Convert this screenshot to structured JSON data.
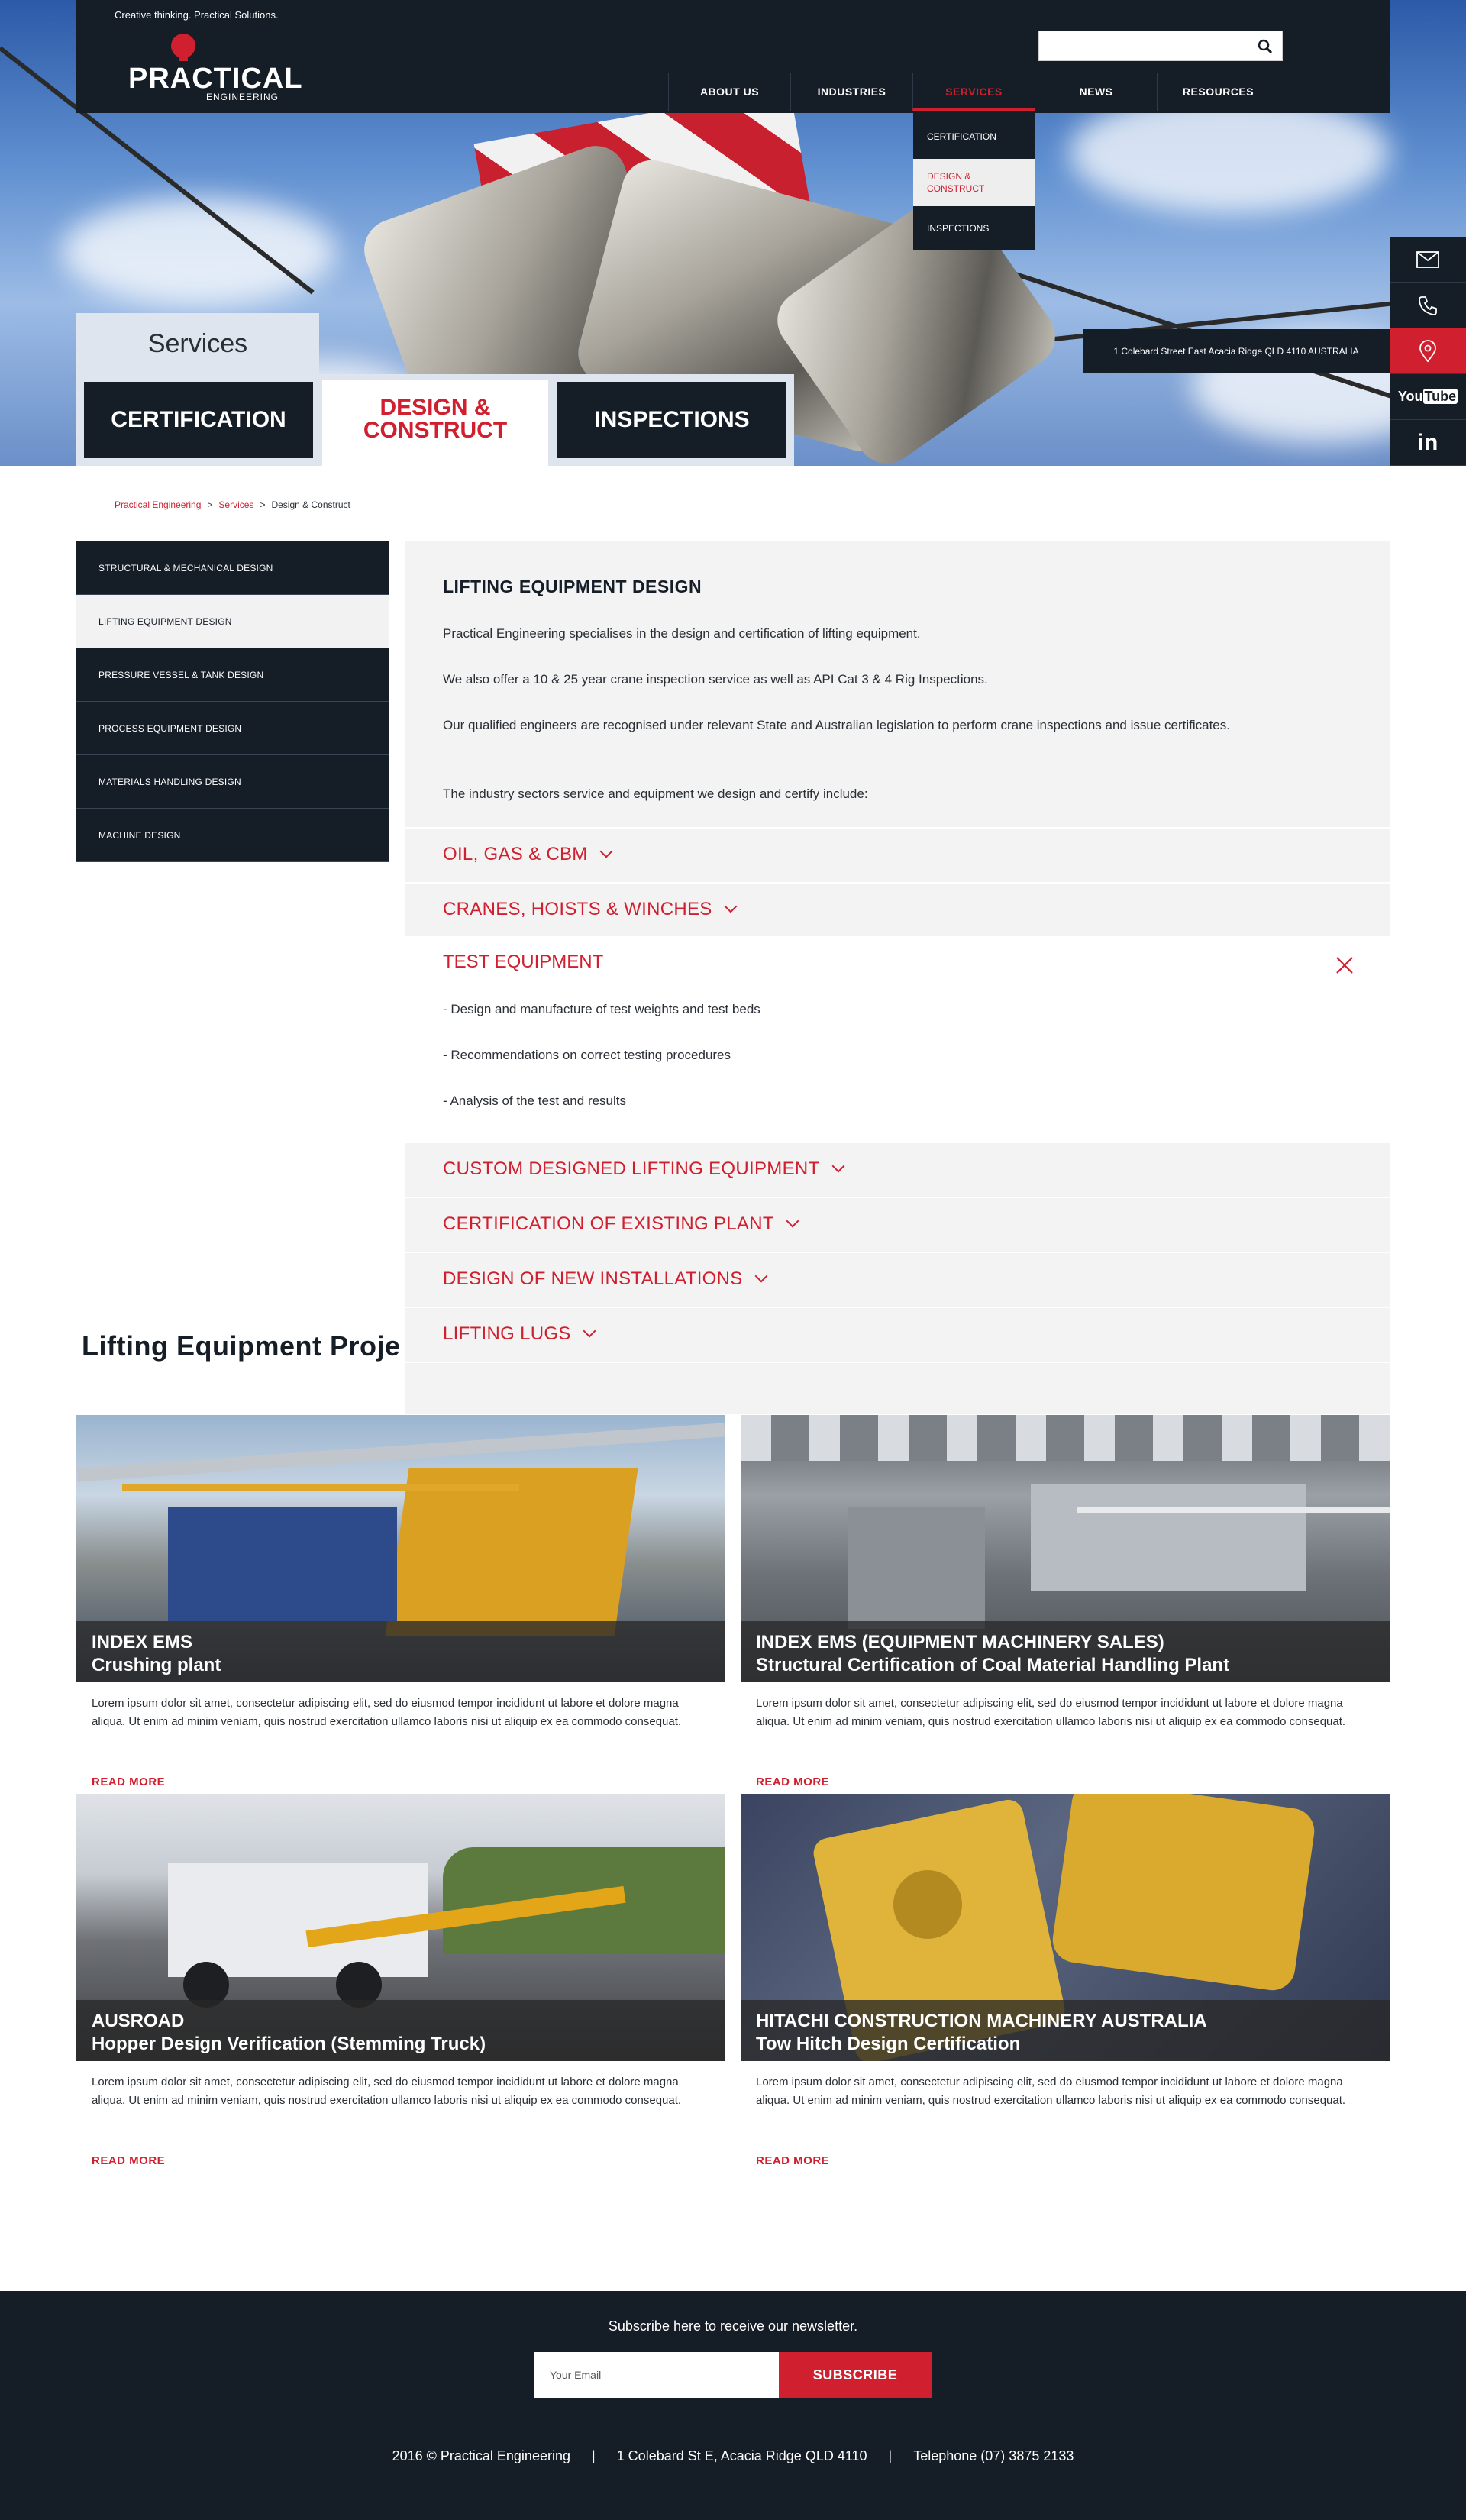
{
  "header": {
    "tagline": "Creative thinking. Practical Solutions.",
    "logo_word": "PRACTICAL",
    "logo_sub": "ENGINEERING",
    "search_placeholder": "",
    "nav": [
      "ABOUT US",
      "INDUSTRIES",
      "SERVICES",
      "NEWS",
      "RESOURCES"
    ],
    "active_nav": "SERVICES",
    "dropdown": [
      "CERTIFICATION",
      "DESIGN & CONSTRUCT",
      "INSPECTIONS"
    ]
  },
  "hero": {
    "panel_title": "Services",
    "tabs": [
      "CERTIFICATION",
      "DESIGN & CONSTRUCT",
      "INSPECTIONS"
    ],
    "address_popup": "1 Colebard Street East Acacia Ridge QLD 4110 AUSTRALIA"
  },
  "social_icons": [
    "mail-icon",
    "phone-icon",
    "location-pin-icon",
    "youtube-icon",
    "linkedin-icon"
  ],
  "breadcrumb": {
    "home": "Practical Engineering",
    "section": "Services",
    "current": "Design & Construct"
  },
  "sidebar": {
    "items": [
      "STRUCTURAL & MECHANICAL DESIGN",
      "LIFTING EQUIPMENT DESIGN",
      "PRESSURE VESSEL & TANK DESIGN",
      "PROCESS EQUIPMENT DESIGN",
      "MATERIALS HANDLING DESIGN",
      "MACHINE DESIGN"
    ],
    "active": "LIFTING EQUIPMENT DESIGN"
  },
  "content": {
    "title": "LIFTING EQUIPMENT DESIGN",
    "paragraphs": [
      "Practical Engineering specialises in the design and certification of lifting equipment.",
      "We also offer a 10 & 25 year crane inspection service as well as API Cat 3 & 4 Rig Inspections.",
      "Our qualified engineers are recognised under relevant State and Australian legislation to perform crane inspections and issue certificates.",
      "The industry sectors service and equipment we design and certify include:"
    ],
    "accordion": [
      "OIL, GAS & CBM",
      "CRANES, HOISTS & WINCHES",
      "TEST EQUIPMENT",
      "CUSTOM DESIGNED LIFTING EQUIPMENT",
      "CERTIFICATION OF EXISTING PLANT",
      "DESIGN OF NEW INSTALLATIONS",
      "LIFTING LUGS"
    ],
    "open_item": "TEST EQUIPMENT",
    "open_bullets": [
      "- Design and manufacture of test weights and test beds",
      "- Recommendations on correct testing procedures",
      "- Analysis of the test and results"
    ]
  },
  "projects": {
    "title": "Lifting Equipment Proje",
    "cards": [
      {
        "client": "INDEX EMS",
        "subtitle": "Crushing plant",
        "desc": "Lorem ipsum dolor sit amet, consectetur adipiscing elit, sed do eiusmod tempor incididunt ut labore et dolore magna aliqua. Ut enim ad minim veniam, quis nostrud exercitation ullamco laboris nisi ut aliquip ex ea commodo consequat.",
        "more": "READ MORE"
      },
      {
        "client": "INDEX EMS (EQUIPMENT MACHINERY SALES)",
        "subtitle": "Structural Certification of Coal Material Handling Plant",
        "desc": "Lorem ipsum dolor sit amet, consectetur adipiscing elit, sed do eiusmod tempor incididunt ut labore et dolore magna aliqua. Ut enim ad minim veniam, quis nostrud exercitation ullamco laboris nisi ut aliquip ex ea commodo consequat.",
        "more": "READ MORE"
      },
      {
        "client": "AUSROAD",
        "subtitle": "Hopper Design Verification (Stemming Truck)",
        "desc": "Lorem ipsum dolor sit amet, consectetur adipiscing elit, sed do eiusmod tempor incididunt ut labore et dolore magna aliqua. Ut enim ad minim veniam, quis nostrud exercitation ullamco laboris nisi ut aliquip ex ea commodo consequat.",
        "more": "READ MORE"
      },
      {
        "client": "HITACHI CONSTRUCTION MACHINERY AUSTRALIA",
        "subtitle": "Tow Hitch Design Certification",
        "desc": "Lorem ipsum dolor sit amet, consectetur adipiscing elit, sed do eiusmod tempor incididunt ut labore et dolore magna aliqua. Ut enim ad minim veniam, quis nostrud exercitation ullamco laboris nisi ut aliquip ex ea commodo consequat.",
        "more": "READ MORE"
      }
    ]
  },
  "footer": {
    "subscribe_text": "Subscribe here to receive our newsletter.",
    "email_placeholder": "Your Email",
    "subscribe_button": "SUBSCRIBE",
    "copyright": "2016 © Practical Engineering",
    "address": "1 Colebard St E, Acacia Ridge QLD 4110",
    "phone": "Telephone (07) 3875 2133"
  },
  "colors": {
    "brand_red": "#d0202f",
    "navy": "#151d27",
    "panel_grey": "#f3f3f3"
  }
}
